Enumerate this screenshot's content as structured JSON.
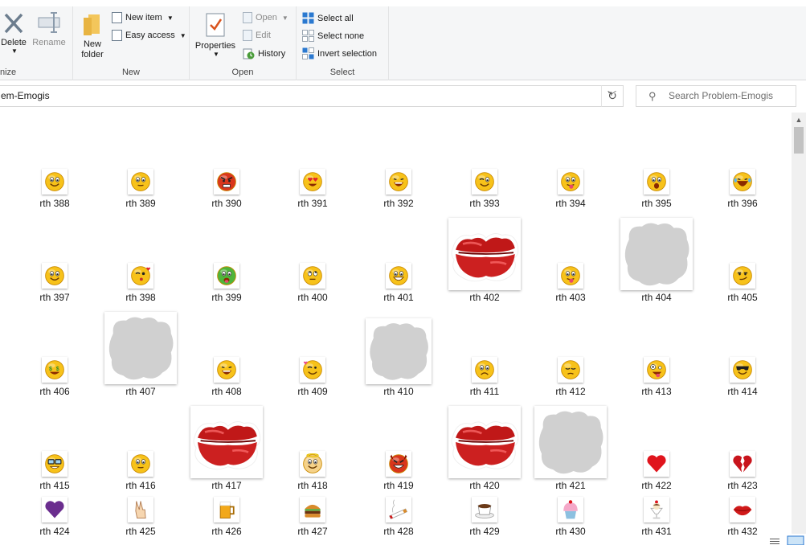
{
  "ribbon": {
    "organize": {
      "label": "nize",
      "delete_label": "Delete",
      "rename_label": "Rename"
    },
    "new": {
      "label": "New",
      "new_folder_label": "New\nfolder",
      "new_item_label": "New item",
      "easy_access_label": "Easy access"
    },
    "open": {
      "label": "Open",
      "properties_label": "Properties",
      "open_label": "Open",
      "edit_label": "Edit",
      "history_label": "History"
    },
    "select": {
      "label": "Select",
      "select_all_label": "Select all",
      "select_none_label": "Select none",
      "invert_label": "Invert selection"
    }
  },
  "address": {
    "path": "em-Emogis"
  },
  "search": {
    "placeholder": "Search Problem-Emogis"
  },
  "items": [
    {
      "label": "rth 388",
      "icon": "smile"
    },
    {
      "label": "rth 389",
      "icon": "neutral"
    },
    {
      "label": "rth 390",
      "icon": "angry"
    },
    {
      "label": "rth 391",
      "icon": "heart-eyes"
    },
    {
      "label": "rth 392",
      "icon": "laugh"
    },
    {
      "label": "rth 393",
      "icon": "wink"
    },
    {
      "label": "rth 394",
      "icon": "tongue"
    },
    {
      "label": "rth 395",
      "icon": "shocked"
    },
    {
      "label": "rth 396",
      "icon": "cry-laugh"
    },
    {
      "label": "rth 397",
      "icon": "smile"
    },
    {
      "label": "rth 398",
      "icon": "kiss"
    },
    {
      "label": "rth 399",
      "icon": "sick"
    },
    {
      "label": "rth 400",
      "icon": "eyeroll"
    },
    {
      "label": "rth 401",
      "icon": "grin"
    },
    {
      "label": "rth 402",
      "icon": "lips"
    },
    {
      "label": "rth 403",
      "icon": "tongue"
    },
    {
      "label": "rth 404",
      "icon": "blob"
    },
    {
      "label": "rth 405",
      "icon": "smirk"
    },
    {
      "label": "rth 406",
      "icon": "money"
    },
    {
      "label": "rth 407",
      "icon": "blob"
    },
    {
      "label": "rth 408",
      "icon": "laugh"
    },
    {
      "label": "rth 409",
      "icon": "wink-heart"
    },
    {
      "label": "rth 410",
      "icon": "blob"
    },
    {
      "label": "rth 411",
      "icon": "sad"
    },
    {
      "label": "rth 412",
      "icon": "sleepy"
    },
    {
      "label": "rth 413",
      "icon": "crazy"
    },
    {
      "label": "rth 414",
      "icon": "cool"
    },
    {
      "label": "rth 415",
      "icon": "nerd"
    },
    {
      "label": "rth 416",
      "icon": "neutral"
    },
    {
      "label": "rth 417",
      "icon": "lips"
    },
    {
      "label": "rth 418",
      "icon": "angel"
    },
    {
      "label": "rth 419",
      "icon": "devil"
    },
    {
      "label": "rth 420",
      "icon": "lips"
    },
    {
      "label": "rth 421",
      "icon": "blob"
    },
    {
      "label": "rth 422",
      "icon": "heart"
    },
    {
      "label": "rth 423",
      "icon": "broken-heart"
    },
    {
      "label": "rth 424",
      "icon": "purple-heart"
    },
    {
      "label": "rth 425",
      "icon": "peace"
    },
    {
      "label": "rth 426",
      "icon": "beer"
    },
    {
      "label": "rth 427",
      "icon": "burger"
    },
    {
      "label": "rth 428",
      "icon": "cigarette"
    },
    {
      "label": "rth 429",
      "icon": "coffee"
    },
    {
      "label": "rth 430",
      "icon": "cupcake"
    },
    {
      "label": "rth 431",
      "icon": "sundae"
    },
    {
      "label": "rth 432",
      "icon": "small-lips"
    }
  ],
  "colors": {
    "ribbon_bg": "#f5f6f7",
    "emoji_yellow": "#f7c21a",
    "lips_red": "#c82020",
    "blob_gray": "#cfcfcf",
    "select_blue": "#2b79d0"
  }
}
